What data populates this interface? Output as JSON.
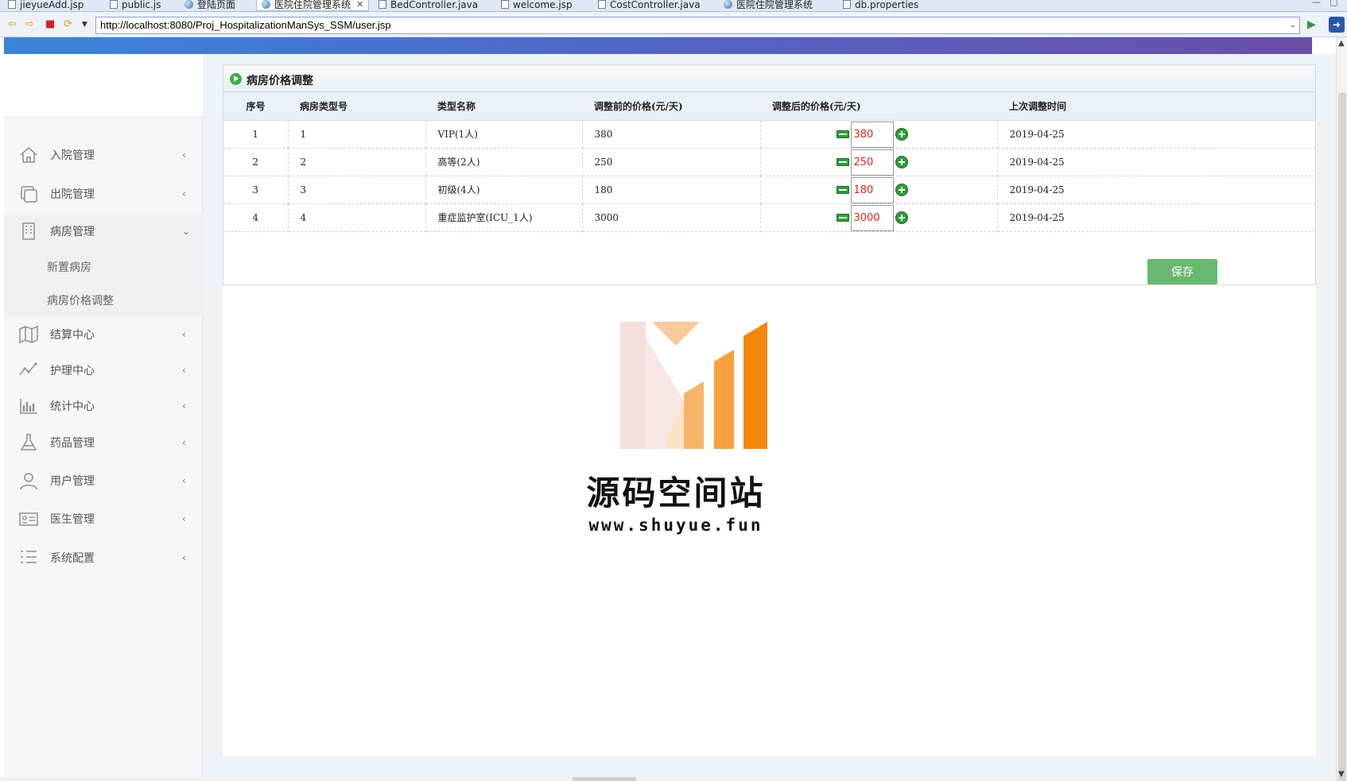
{
  "ide_tabs": [
    {
      "label": "jieyueAdd.jsp",
      "icon": "file-icon"
    },
    {
      "label": "public.js",
      "icon": "file-icon"
    },
    {
      "label": "登陆页面",
      "icon": "globe-icon"
    },
    {
      "label": "医院住院管理系统",
      "icon": "globe-icon",
      "active": true
    },
    {
      "label": "BedController.java",
      "icon": "file-icon"
    },
    {
      "label": "welcome.jsp",
      "icon": "file-icon"
    },
    {
      "label": "CostController.java",
      "icon": "file-icon"
    },
    {
      "label": "医院住院管理系统",
      "icon": "globe-icon"
    },
    {
      "label": "db.properties",
      "icon": "file-icon"
    }
  ],
  "browser": {
    "url": "http://localhost:8080/Proj_HospitalizationManSys_SSM/user.jsp"
  },
  "sidebar": {
    "items": [
      {
        "label": "入院管理",
        "icon": "home-icon"
      },
      {
        "label": "出院管理",
        "icon": "copy-icon"
      },
      {
        "label": "病房管理",
        "icon": "building-icon",
        "open": true
      },
      {
        "label": "结算中心",
        "icon": "map-icon"
      },
      {
        "label": "护理中心",
        "icon": "trend-icon"
      },
      {
        "label": "统计中心",
        "icon": "bar-chart-icon"
      },
      {
        "label": "药品管理",
        "icon": "flask-icon"
      },
      {
        "label": "用户管理",
        "icon": "user-icon"
      },
      {
        "label": "医生管理",
        "icon": "id-card-icon"
      },
      {
        "label": "系统配置",
        "icon": "list-icon"
      }
    ],
    "submenu": [
      {
        "label": "新置病房"
      },
      {
        "label": "病房价格调整"
      }
    ]
  },
  "panel": {
    "title": "病房价格调整",
    "columns": [
      "序号",
      "病房类型号",
      "类型名称",
      "调整前的价格(元/天)",
      "调整后的价格(元/天)",
      "上次调整时间"
    ],
    "rows": [
      {
        "idx": "1",
        "type_no": "1",
        "type_name": "VIP(1人)",
        "old_price": "380",
        "new_price": "380",
        "last_time": "2019-04-25"
      },
      {
        "idx": "2",
        "type_no": "2",
        "type_name": "高等(2人)",
        "old_price": "250",
        "new_price": "250",
        "last_time": "2019-04-25"
      },
      {
        "idx": "3",
        "type_no": "3",
        "type_name": "初级(4人)",
        "old_price": "180",
        "new_price": "180",
        "last_time": "2019-04-25"
      },
      {
        "idx": "4",
        "type_no": "4",
        "type_name": "重症监护室(ICU_1人)",
        "old_price": "3000",
        "new_price": "3000",
        "last_time": "2019-04-25"
      }
    ],
    "save_label": "保存"
  },
  "watermark": {
    "name": "源码空间站",
    "url": "www.shuyue.fun"
  },
  "colors": {
    "accent_green": "#68b86f",
    "price_red": "#e02020",
    "band_start": "#3a86d9",
    "band_end": "#6b4ea8",
    "logo_orange": "#f5870c"
  }
}
